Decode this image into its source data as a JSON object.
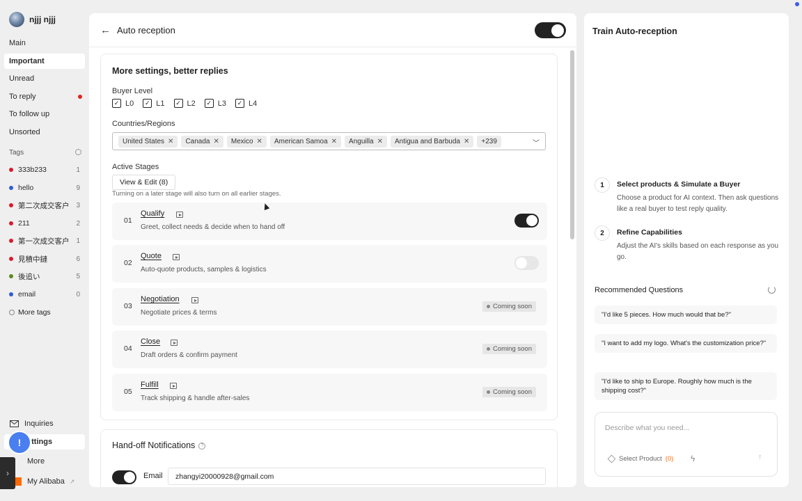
{
  "profile": {
    "name": "njjj njjj"
  },
  "nav": [
    {
      "label": "Main",
      "active": false
    },
    {
      "label": "Important",
      "active": true
    },
    {
      "label": "Unread",
      "active": false
    },
    {
      "label": "To reply",
      "active": false,
      "dot": true
    },
    {
      "label": "To follow up",
      "active": false
    },
    {
      "label": "Unsorted",
      "active": false
    }
  ],
  "tags_label": "Tags",
  "tags": [
    {
      "label": "333b233",
      "count": "1",
      "color": "#d91a2a"
    },
    {
      "label": "hello",
      "count": "9",
      "color": "#2f5bd6"
    },
    {
      "label": "第二次成交客户",
      "count": "3",
      "color": "#d91a2a"
    },
    {
      "label": "211",
      "count": "2",
      "color": "#d91a2a"
    },
    {
      "label": "第一次成交客户",
      "count": "1",
      "color": "#d91a2a"
    },
    {
      "label": "見積中鏈",
      "count": "6",
      "color": "#d91a2a"
    },
    {
      "label": "後追い",
      "count": "5",
      "color": "#5c8a1e"
    },
    {
      "label": "email",
      "count": "0",
      "color": "#2f5bd6"
    }
  ],
  "more_tags": "More tags",
  "bottom_nav": {
    "inquiries": "Inquiries",
    "settings": "ettings",
    "more": "More",
    "my_alibaba": "My Alibaba"
  },
  "chat_fab": "!",
  "main": {
    "title": "Auto reception",
    "back_glyph": "←",
    "settings_card": {
      "title": "More settings, better replies",
      "buyer_level_label": "Buyer Level",
      "buyer_levels": [
        "L0",
        "L1",
        "L2",
        "L3",
        "L4"
      ],
      "countries_label": "Countries/Regions",
      "countries": [
        "United States",
        "Canada",
        "Mexico",
        "American Samoa",
        "Anguilla",
        "Antigua and Barbuda"
      ],
      "countries_more": "+239",
      "active_stages_label": "Active Stages",
      "view_edit": "View & Edit (8)",
      "hint": "Turning on a later stage will also turn on all earlier stages.",
      "stages": [
        {
          "num": "01",
          "name": "Qualify",
          "desc": "Greet, collect needs & decide when to hand off",
          "state": "on"
        },
        {
          "num": "02",
          "name": "Quote",
          "desc": "Auto-quote products, samples & logistics",
          "state": "off"
        },
        {
          "num": "03",
          "name": "Negotiation",
          "desc": "Negotiate prices & terms",
          "state": "Coming soon"
        },
        {
          "num": "04",
          "name": "Close",
          "desc": "Draft orders & confirm payment",
          "state": "Coming soon"
        },
        {
          "num": "05",
          "name": "Fulfill",
          "desc": "Track shipping & handle after-sales",
          "state": "Coming soon"
        }
      ]
    },
    "handoff_card": {
      "title": "Hand-off Notifications",
      "email_label": "Email",
      "email_value": "zhangyi20000928@gmail.com"
    }
  },
  "right": {
    "title": "Train Auto-reception",
    "steps": [
      {
        "num": "1",
        "title": "Select products & Simulate a Buyer",
        "desc": "Choose a product for AI context. Then ask questions like a real buyer to test reply quality."
      },
      {
        "num": "2",
        "title": "Refine Capabilities",
        "desc": "Adjust the AI's skills based on each response as you go."
      }
    ],
    "rec_title": "Recommended Questions",
    "questions": [
      "\"I'd like 5 pieces. How much would that be?\"",
      "\"I want to add my logo. What's the customization price?\"",
      "\"I'd like to ship to Europe. Roughly how much is the shipping cost?\""
    ],
    "compose_placeholder": "Describe what you need...",
    "select_product": "Select Product",
    "select_product_count": "(0)"
  }
}
